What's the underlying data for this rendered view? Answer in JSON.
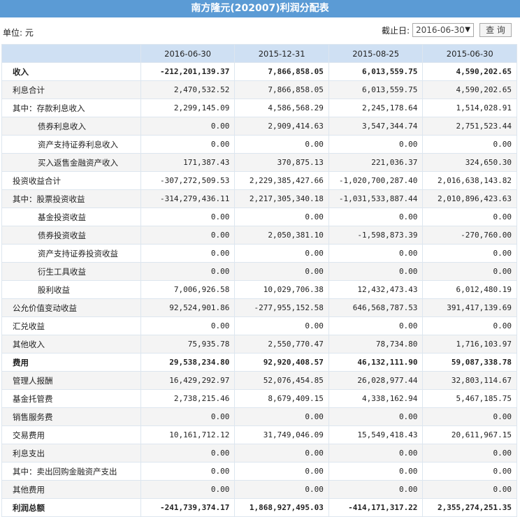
{
  "title": "南方隆元(202007)利润分配表",
  "unit_label": "单位: 元",
  "date_label": "截止日:",
  "selected_date": "2016-06-30",
  "query_button": "查 询",
  "headers": [
    "",
    "2016-06-30",
    "2015-12-31",
    "2015-08-25",
    "2015-06-30"
  ],
  "rows": [
    {
      "label": "收入",
      "bold": true,
      "indent": false,
      "values": [
        "-212,201,139.37",
        "7,866,858.05",
        "6,013,559.75",
        "4,590,202.65"
      ]
    },
    {
      "label": "利息合计",
      "bold": false,
      "indent": false,
      "values": [
        "2,470,532.52",
        "7,866,858.05",
        "6,013,559.75",
        "4,590,202.65"
      ]
    },
    {
      "label": "其中：存款利息收入",
      "bold": false,
      "indent": false,
      "values": [
        "2,299,145.09",
        "4,586,568.29",
        "2,245,178.64",
        "1,514,028.91"
      ]
    },
    {
      "label": "债券利息收入",
      "bold": false,
      "indent": true,
      "values": [
        "0.00",
        "2,909,414.63",
        "3,547,344.74",
        "2,751,523.44"
      ]
    },
    {
      "label": "资产支持证券利息收入",
      "bold": false,
      "indent": true,
      "values": [
        "0.00",
        "0.00",
        "0.00",
        "0.00"
      ]
    },
    {
      "label": "买入返售金融资产收入",
      "bold": false,
      "indent": true,
      "values": [
        "171,387.43",
        "370,875.13",
        "221,036.37",
        "324,650.30"
      ]
    },
    {
      "label": "投资收益合计",
      "bold": false,
      "indent": false,
      "values": [
        "-307,272,509.53",
        "2,229,385,427.66",
        "-1,020,700,287.40",
        "2,016,638,143.82"
      ]
    },
    {
      "label": "其中：股票投资收益",
      "bold": false,
      "indent": false,
      "values": [
        "-314,279,436.11",
        "2,217,305,340.18",
        "-1,031,533,887.44",
        "2,010,896,423.63"
      ]
    },
    {
      "label": "基金投资收益",
      "bold": false,
      "indent": true,
      "values": [
        "0.00",
        "0.00",
        "0.00",
        "0.00"
      ]
    },
    {
      "label": "债券投资收益",
      "bold": false,
      "indent": true,
      "values": [
        "0.00",
        "2,050,381.10",
        "-1,598,873.39",
        "-270,760.00"
      ]
    },
    {
      "label": "资产支持证券投资收益",
      "bold": false,
      "indent": true,
      "values": [
        "0.00",
        "0.00",
        "0.00",
        "0.00"
      ]
    },
    {
      "label": "衍生工具收益",
      "bold": false,
      "indent": true,
      "values": [
        "0.00",
        "0.00",
        "0.00",
        "0.00"
      ]
    },
    {
      "label": "股利收益",
      "bold": false,
      "indent": true,
      "values": [
        "7,006,926.58",
        "10,029,706.38",
        "12,432,473.43",
        "6,012,480.19"
      ]
    },
    {
      "label": "公允价值变动收益",
      "bold": false,
      "indent": false,
      "values": [
        "92,524,901.86",
        "-277,955,152.58",
        "646,568,787.53",
        "391,417,139.69"
      ]
    },
    {
      "label": "汇兑收益",
      "bold": false,
      "indent": false,
      "values": [
        "0.00",
        "0.00",
        "0.00",
        "0.00"
      ]
    },
    {
      "label": "其他收入",
      "bold": false,
      "indent": false,
      "values": [
        "75,935.78",
        "2,550,770.47",
        "78,734.80",
        "1,716,103.97"
      ]
    },
    {
      "label": "费用",
      "bold": true,
      "indent": false,
      "values": [
        "29,538,234.80",
        "92,920,408.57",
        "46,132,111.90",
        "59,087,338.78"
      ]
    },
    {
      "label": "管理人报酬",
      "bold": false,
      "indent": false,
      "values": [
        "16,429,292.97",
        "52,076,454.85",
        "26,028,977.44",
        "32,803,114.67"
      ]
    },
    {
      "label": "基金托管费",
      "bold": false,
      "indent": false,
      "values": [
        "2,738,215.46",
        "8,679,409.15",
        "4,338,162.94",
        "5,467,185.75"
      ]
    },
    {
      "label": "销售服务费",
      "bold": false,
      "indent": false,
      "values": [
        "0.00",
        "0.00",
        "0.00",
        "0.00"
      ]
    },
    {
      "label": "交易费用",
      "bold": false,
      "indent": false,
      "values": [
        "10,161,712.12",
        "31,749,046.09",
        "15,549,418.43",
        "20,611,967.15"
      ]
    },
    {
      "label": "利息支出",
      "bold": false,
      "indent": false,
      "values": [
        "0.00",
        "0.00",
        "0.00",
        "0.00"
      ]
    },
    {
      "label": "其中：卖出回购金融资产支出",
      "bold": false,
      "indent": false,
      "values": [
        "0.00",
        "0.00",
        "0.00",
        "0.00"
      ]
    },
    {
      "label": "其他费用",
      "bold": false,
      "indent": false,
      "values": [
        "0.00",
        "0.00",
        "0.00",
        "0.00"
      ]
    },
    {
      "label": "利润总额",
      "bold": true,
      "indent": false,
      "values": [
        "-241,739,374.17",
        "1,868,927,495.03",
        "-414,171,317.22",
        "2,355,274,251.35"
      ]
    }
  ]
}
